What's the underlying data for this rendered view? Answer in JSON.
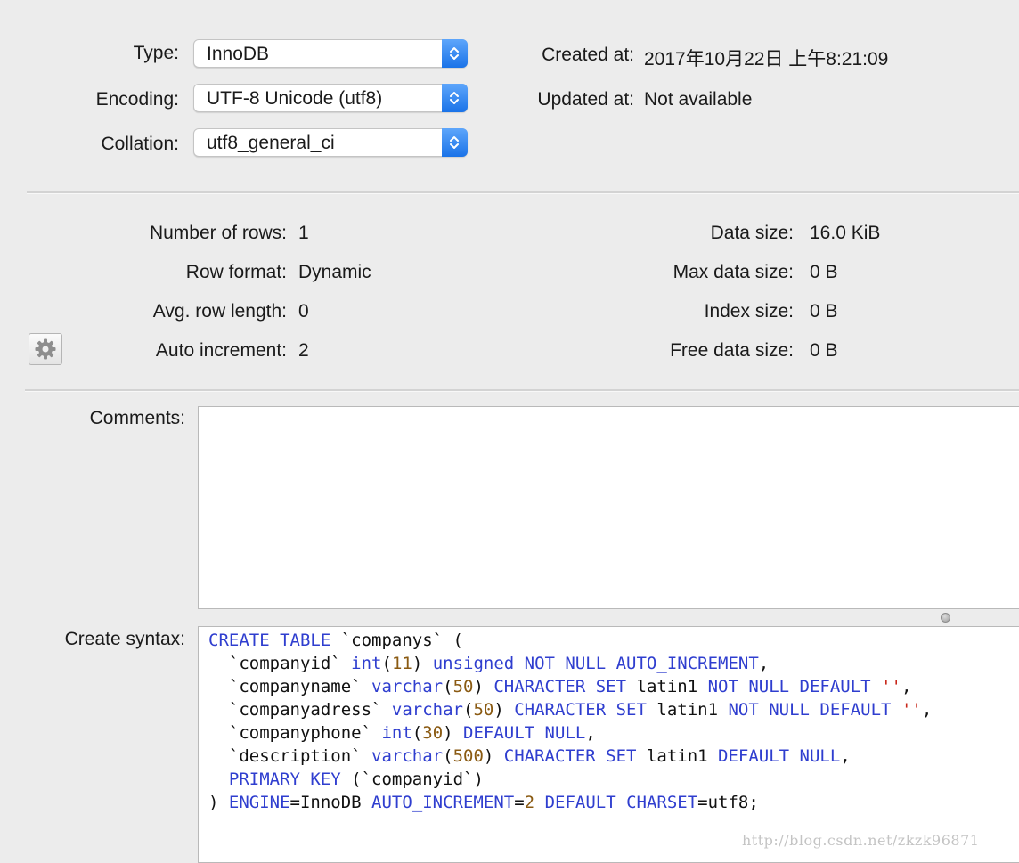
{
  "table_info": {
    "type": {
      "label": "Type:",
      "value": "InnoDB"
    },
    "encoding": {
      "label": "Encoding:",
      "value": "UTF-8 Unicode (utf8)"
    },
    "collation": {
      "label": "Collation:",
      "value": "utf8_general_ci"
    },
    "created_at": {
      "label": "Created at:",
      "value": "2017年10月22日 上午8:21:09"
    },
    "updated_at": {
      "label": "Updated at:",
      "value": "Not available"
    }
  },
  "stats": {
    "number_of_rows": {
      "label": "Number of rows:",
      "value": "1"
    },
    "row_format": {
      "label": "Row format:",
      "value": "Dynamic"
    },
    "avg_row_length": {
      "label": "Avg. row length:",
      "value": "0"
    },
    "auto_increment": {
      "label": "Auto increment:",
      "value": "2"
    },
    "data_size": {
      "label": "Data size:",
      "value": "16.0 KiB"
    },
    "max_data_size": {
      "label": "Max data size:",
      "value": "0 B"
    },
    "index_size": {
      "label": "Index size:",
      "value": "0 B"
    },
    "free_data_size": {
      "label": "Free data size:",
      "value": "0 B"
    }
  },
  "comments": {
    "label": "Comments:",
    "value": ""
  },
  "create_syntax": {
    "label": "Create syntax:",
    "lines": [
      [
        [
          "k",
          "CREATE TABLE"
        ],
        [
          "t",
          " `companys` ("
        ]
      ],
      [
        [
          "t",
          "  `companyid` "
        ],
        [
          "k",
          "int"
        ],
        [
          "t",
          "("
        ],
        [
          "n",
          "11"
        ],
        [
          "t",
          ") "
        ],
        [
          "k",
          "unsigned NOT NULL AUTO_INCREMENT"
        ],
        [
          "t",
          ","
        ]
      ],
      [
        [
          "t",
          "  `companyname` "
        ],
        [
          "k",
          "varchar"
        ],
        [
          "t",
          "("
        ],
        [
          "n",
          "50"
        ],
        [
          "t",
          ") "
        ],
        [
          "k",
          "CHARACTER SET"
        ],
        [
          "t",
          " latin1 "
        ],
        [
          "k",
          "NOT NULL DEFAULT"
        ],
        [
          "t",
          " "
        ],
        [
          "s",
          "''"
        ],
        [
          "t",
          ","
        ]
      ],
      [
        [
          "t",
          "  `companyadress` "
        ],
        [
          "k",
          "varchar"
        ],
        [
          "t",
          "("
        ],
        [
          "n",
          "50"
        ],
        [
          "t",
          ") "
        ],
        [
          "k",
          "CHARACTER SET"
        ],
        [
          "t",
          " latin1 "
        ],
        [
          "k",
          "NOT NULL DEFAULT"
        ],
        [
          "t",
          " "
        ],
        [
          "s",
          "''"
        ],
        [
          "t",
          ","
        ]
      ],
      [
        [
          "t",
          "  `companyphone` "
        ],
        [
          "k",
          "int"
        ],
        [
          "t",
          "("
        ],
        [
          "n",
          "30"
        ],
        [
          "t",
          ") "
        ],
        [
          "k",
          "DEFAULT NULL"
        ],
        [
          "t",
          ","
        ]
      ],
      [
        [
          "t",
          "  `description` "
        ],
        [
          "k",
          "varchar"
        ],
        [
          "t",
          "("
        ],
        [
          "n",
          "500"
        ],
        [
          "t",
          ") "
        ],
        [
          "k",
          "CHARACTER SET"
        ],
        [
          "t",
          " latin1 "
        ],
        [
          "k",
          "DEFAULT NULL"
        ],
        [
          "t",
          ","
        ]
      ],
      [
        [
          "t",
          "  "
        ],
        [
          "k",
          "PRIMARY KEY"
        ],
        [
          "t",
          " (`companyid`)"
        ]
      ],
      [
        [
          "t",
          ") "
        ],
        [
          "k",
          "ENGINE"
        ],
        [
          "t",
          "=InnoDB "
        ],
        [
          "k",
          "AUTO_INCREMENT"
        ],
        [
          "t",
          "="
        ],
        [
          "n",
          "2"
        ],
        [
          "t",
          " "
        ],
        [
          "k",
          "DEFAULT CHARSET"
        ],
        [
          "t",
          "=utf8;"
        ]
      ]
    ]
  },
  "icons": {
    "settings": "gear-icon",
    "popup_arrows": "up-down-chevron-icon"
  },
  "colors": {
    "keyword": "#2f3ecf",
    "number": "#8a5a12",
    "string": "#c8271a",
    "popup_accent": "#1a73e8"
  },
  "watermark": "http://blog.csdn.net/zkzk96871"
}
